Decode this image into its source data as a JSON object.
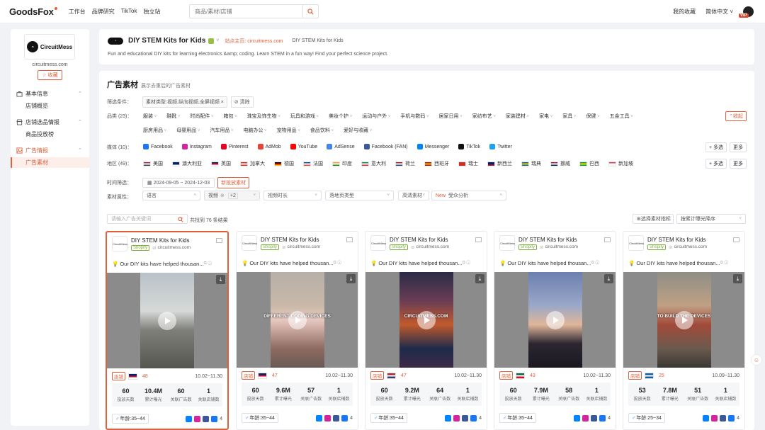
{
  "topbar": {
    "logo": "GoodsFox",
    "nav": [
      "工作台",
      "品牌研究",
      "TikTok",
      "独立站"
    ],
    "search_placeholder": "商品/素材/店铺",
    "right": [
      "我的收藏",
      "简体中文 ˅"
    ],
    "vip": "VIP"
  },
  "sidebar": {
    "brand": "CircuitMess",
    "domain": "circuitmess.com",
    "collect": "☆ 收藏",
    "groups": [
      {
        "label": "基本信息",
        "subs": [
          "店铺概览"
        ]
      },
      {
        "label": "店铺选品情报",
        "subs": [
          "商品投放榜"
        ]
      },
      {
        "label": "广告情报",
        "subs": [
          "广告素材"
        ]
      }
    ]
  },
  "header": {
    "title": "DIY STEM Kits for Kids",
    "site_link": "站点主页: circuitmess.com",
    "title2": "DIY STEM Kits for Kids",
    "desc": "Fun and educational DIY kits for learning electronics &amp; coding. Learn STEM in a fun way! Find your perfect science project."
  },
  "main": {
    "title": "广告素材",
    "subtitle": "展示去重后的广告素材",
    "filter_label": "筛选条件：",
    "filter_tag": "素材类型:视频,纵向视频,全屏视频 ×",
    "clear": "⊘ 清除",
    "cat_label": "品类 (23)：",
    "cats1": [
      "服装",
      "鞋靴",
      "时尚配件",
      "箱包",
      "珠宝及饰生物",
      "玩具和游戏",
      "美妆个护",
      "运动与户外",
      "手机与数码",
      "居家日用",
      "家纺布艺",
      "家装建材",
      "家电",
      "家具",
      "保健",
      "五金工具"
    ],
    "cats2": [
      "厨房用品",
      "母婴用品",
      "汽车用品",
      "电脑办公",
      "宠物用品",
      "食品饮料",
      "爱好与收藏"
    ],
    "collapse": "⌃收起",
    "media_label": "媒体 (10)：",
    "media": [
      {
        "name": "Facebook",
        "color": "#1877f2"
      },
      {
        "name": "Instagram",
        "color": "#d6249f"
      },
      {
        "name": "Pinterest",
        "color": "#e60023"
      },
      {
        "name": "AdMob",
        "color": "#ea4335"
      },
      {
        "name": "YouTube",
        "color": "#ff0000"
      },
      {
        "name": "AdSense",
        "color": "#4285f4"
      },
      {
        "name": "Facebook (FAN)",
        "color": "#3b5998"
      },
      {
        "name": "Messenger",
        "color": "#0084ff"
      },
      {
        "name": "TikTok",
        "color": "#111111"
      },
      {
        "name": "Twitter",
        "color": "#1da1f2"
      }
    ],
    "multi": "+ 多选",
    "more": "更多",
    "region_label": "地区 (49)：",
    "regions": [
      "美国",
      "澳大利亚",
      "英国",
      "加拿大",
      "德国",
      "法国",
      "印度",
      "意大利",
      "荷兰",
      "西班牙",
      "瑞士",
      "新西兰",
      "瑞典",
      "挪威",
      "巴西",
      "新加坡"
    ],
    "time_label": "时间筛选：",
    "date_range": "2024-09-05 ~ 2024-12-03",
    "new_ads": "新投放素材",
    "attr_label": "素材属性：",
    "sel_lang": "语言",
    "sel_video": "视频",
    "sel_plus": "+2",
    "sel_duration": "视频时长",
    "sel_landing": "落地页类型",
    "sel_hd": "高清素材",
    "sel_new": "New",
    "sel_audience": "受众分析",
    "search_ph": "请输入广告关键词",
    "found": "共找到 76 条结果",
    "pick_metric": "选择素材指标",
    "sort": "按累计曝光降序"
  },
  "cards": [
    {
      "title": "DIY STEM Kits for Kids",
      "shop": "Shopify",
      "domain": "circuitmess.com",
      "text": "Our DIY kits have helped thousan...",
      "caption": "",
      "flag": "uk",
      "count": "48",
      "date": "10.02~11.30",
      "days": "60",
      "imps": "10.4M",
      "ads": "60",
      "stores": "1",
      "age": "年龄:35~44",
      "more": "4"
    },
    {
      "title": "DIY STEM Kits for Kids",
      "shop": "Shopify",
      "domain": "circuitmess.com",
      "text": "Our DIY kits have helped thousan...",
      "caption": "DIFFERENT CODING DEVICES",
      "flag": "uk",
      "count": "47",
      "date": "10.02~11.30",
      "days": "60",
      "imps": "9.6M",
      "ads": "57",
      "stores": "1",
      "age": "年龄:35~44",
      "more": "4"
    },
    {
      "title": "DIY STEM Kits for Kids",
      "shop": "Shopify",
      "domain": "circuitmess.com",
      "text": "Our DIY kits have helped thousan...",
      "caption": "CIRCUITMESS.COM",
      "flag": "us",
      "count": "47",
      "date": "10.02~11.30",
      "days": "60",
      "imps": "9.2M",
      "ads": "64",
      "stores": "1",
      "age": "年龄:35~44",
      "more": "4"
    },
    {
      "title": "DIY STEM Kits for Kids",
      "shop": "Shopify",
      "domain": "circuitmess.com",
      "text": "Our DIY kits have helped thousan...",
      "caption": "",
      "flag": "mx",
      "count": "43",
      "date": "10.02~11.30",
      "days": "60",
      "imps": "7.9M",
      "ads": "58",
      "stores": "1",
      "age": "年龄:35~44",
      "more": "4"
    },
    {
      "title": "DIY STEM Kits for Kids",
      "shop": "Shopify",
      "domain": "circuitmess.com",
      "text": "Our DIY kits have helped thousan...",
      "caption": "TO BUILD THE DEVICES",
      "flag": "gr",
      "count": "25",
      "date": "10.09~11.30",
      "days": "53",
      "imps": "7.8M",
      "ads": "51",
      "stores": "1",
      "age": "年龄:25~34",
      "more": "4"
    }
  ],
  "stat_labels": [
    "投放天数",
    "累计曝光",
    "关联广告数",
    "关联店铺数"
  ],
  "store_label": "店铺",
  "colors": {
    "accent": "#e0603b",
    "shopify": "#7fb03d",
    "bg": "#f1f2f5"
  }
}
